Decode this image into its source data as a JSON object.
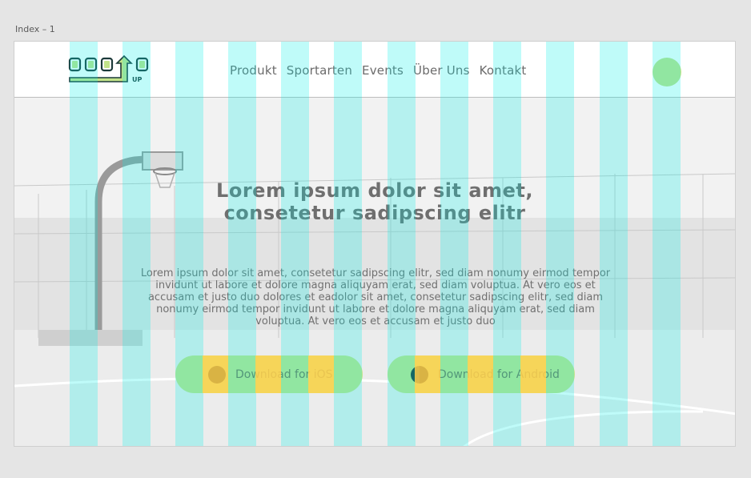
{
  "frame": {
    "label": "Index – 1"
  },
  "header": {
    "logo_text": "SQUAD UP",
    "nav": [
      {
        "label": "Produkt"
      },
      {
        "label": "Sportarten"
      },
      {
        "label": "Events"
      },
      {
        "label": "Über Uns"
      },
      {
        "label": "Kontakt"
      }
    ]
  },
  "hero": {
    "title_line1": "Lorem ipsum dolor sit amet,",
    "title_line2": "consetetur sadipscing elitr",
    "body_line1": "Lorem ipsum dolor sit amet, consetetur sadipscing elitr, sed diam nonumy eirmod tempor",
    "body_line2": "invidunt ut labore et dolore magna aliquyam erat, sed diam voluptua. At vero eos et",
    "body_line3": "accusam et justo duo dolores et eadolor sit amet, consetetur sadipscing elitr, sed diam",
    "body_line4": "nonumy eirmod tempor invidunt ut labore et dolore magna aliquyam erat, sed diam",
    "body_line5": "voluptua. At vero eos et accusam et justo duo",
    "buttons": {
      "ios_label": "Download for iOS",
      "android_label": "Download for Android"
    }
  },
  "colors": {
    "accent_green": "#c2e38a",
    "grid_cyan": "#00f0e6",
    "grid_yellow": "#ffd250",
    "logo_dark": "#1c3a3a"
  }
}
